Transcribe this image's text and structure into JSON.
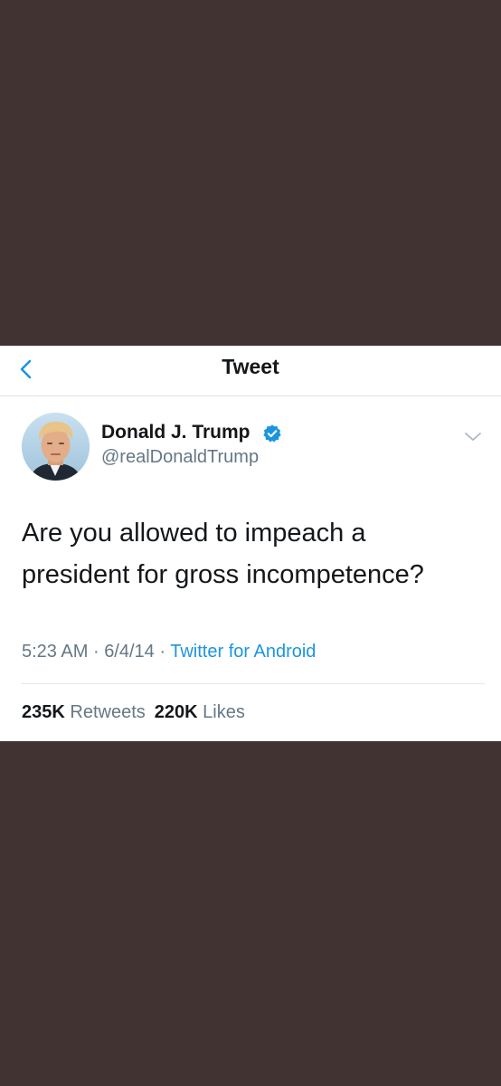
{
  "nav": {
    "title": "Tweet",
    "back_icon": "chevron-left-icon"
  },
  "author": {
    "display_name": "Donald J. Trump",
    "handle": "@realDonaldTrump",
    "verified_icon": "verified-badge-icon"
  },
  "tweet": {
    "text": "Are you allowed to impeach a president for gross incompetence?",
    "time": "5:23 AM",
    "separator": "·",
    "date": "6/4/14",
    "source": "Twitter for Android"
  },
  "stats": {
    "retweets_count": "235K",
    "retweets_label": "Retweets",
    "likes_count": "220K",
    "likes_label": "Likes"
  },
  "colors": {
    "background": "#403332",
    "accent": "#1b95e0",
    "text_primary": "#14171a",
    "text_secondary": "#657786"
  }
}
